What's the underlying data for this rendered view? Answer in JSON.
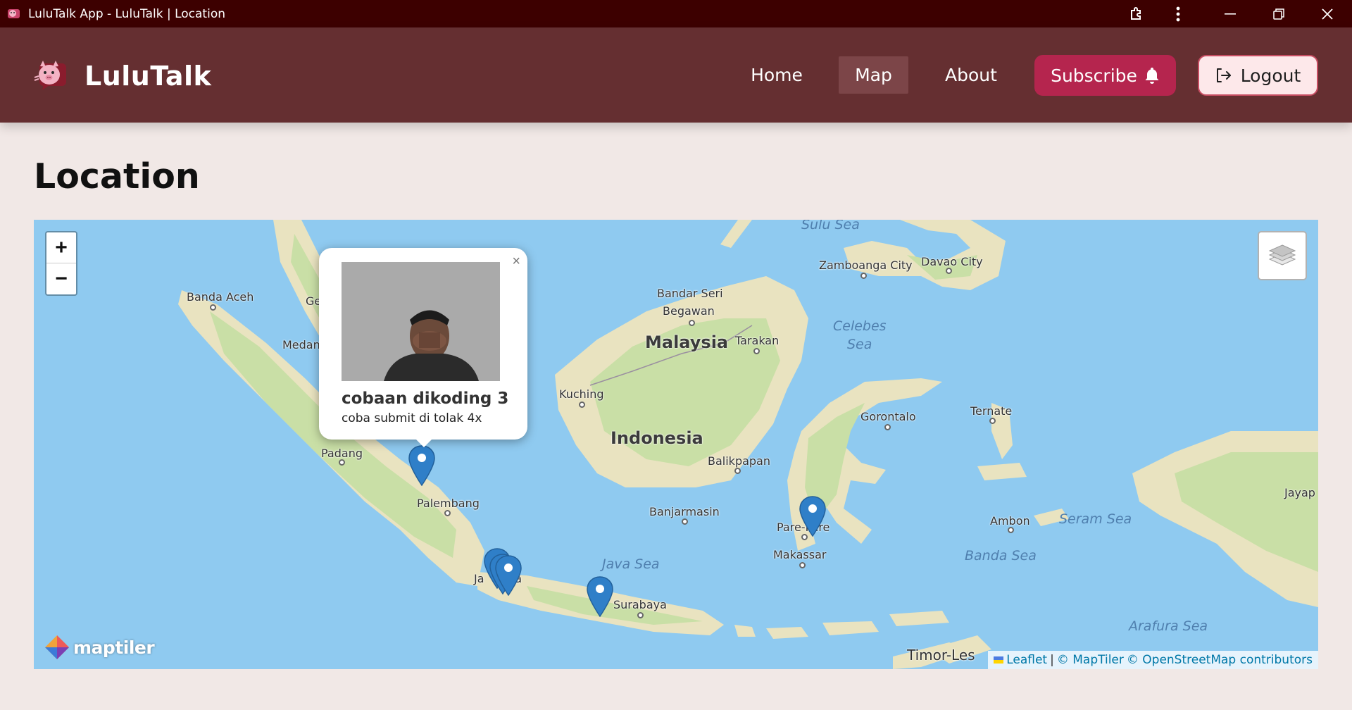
{
  "window": {
    "title": "LuluTalk App - LuluTalk | Location",
    "controls": [
      "extensions-icon",
      "more-icon",
      "minimize-icon",
      "restore-icon",
      "close-icon"
    ]
  },
  "header": {
    "brand": "LuluTalk",
    "nav": [
      {
        "label": "Home",
        "active": false
      },
      {
        "label": "Map",
        "active": true
      },
      {
        "label": "About",
        "active": false
      }
    ],
    "subscribe_label": "Subscribe",
    "logout_label": "Logout",
    "colors": {
      "header_bg": "#652f31",
      "subscribe_bg": "#b5254e",
      "logout_bg": "#fde8ea",
      "titlebar_bg": "#3d0000"
    }
  },
  "page": {
    "title": "Location"
  },
  "map": {
    "zoom_in": "+",
    "zoom_out": "−",
    "provider_logo": "maptiler",
    "attribution": {
      "leaflet": "Leaflet",
      "separator": "|",
      "maptiler": "© MapTiler",
      "osm": "© OpenStreetMap contributors"
    },
    "labels": {
      "countries": [
        "Malaysia",
        "Indonesia"
      ],
      "cities": [
        "Banda Aceh",
        "Ge",
        "Medan",
        "Padang",
        "Palembang",
        "Ja",
        "ta",
        "Surabaya",
        "Bandar Seri",
        "Begawan",
        "Tarakan",
        "Kuching",
        "Balikpapan",
        "Banjarmasin",
        "Pare-Pare",
        "Makassar",
        "Zamboanga City",
        "Davao City",
        "Gorontalo",
        "Ternate",
        "Ambon",
        "Jayap",
        "Timor-Les"
      ],
      "seas": [
        "Sulu Sea",
        "Celebes",
        "Sea",
        "Java Sea",
        "Seram Sea",
        "Banda Sea",
        "Arafura Sea"
      ]
    },
    "marker_count": 6
  },
  "popup": {
    "close": "×",
    "title": "cobaan dikoding 3",
    "description": "coba submit di tolak 4x"
  }
}
